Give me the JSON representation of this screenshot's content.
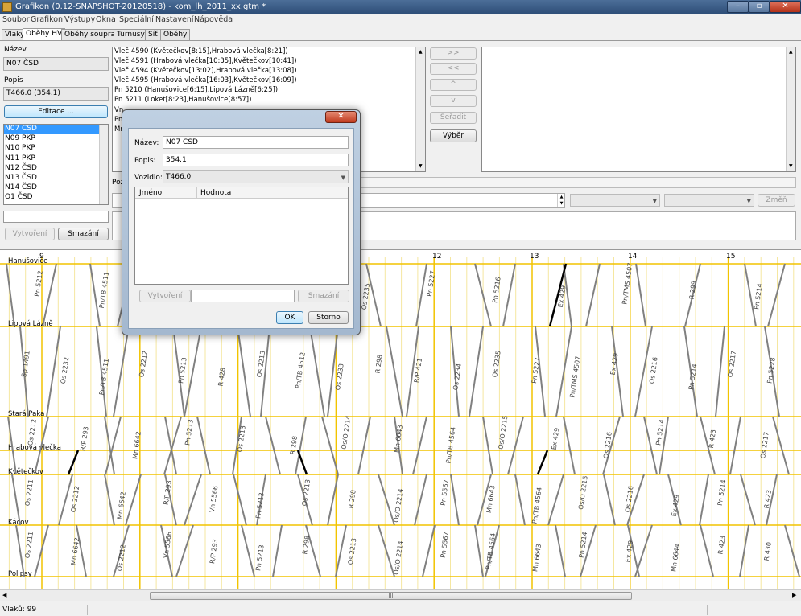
{
  "window": {
    "title": "Grafikon (0.12-SNAPSHOT-20120518) - kom_lh_2011_xx.gtm *",
    "min_glyph": "–",
    "max_glyph": "▫",
    "close_glyph": "✕"
  },
  "menu": [
    "Soubor",
    "Grafikon",
    "Výstupy",
    "Okna",
    "Speciální",
    "Nastavení",
    "Nápověda"
  ],
  "tabs": [
    "Vlaky",
    "Oběhy HV",
    "Oběhy souprav",
    "Turnusy",
    "Síť",
    "Oběhy"
  ],
  "active_tab": 1,
  "left_panel": {
    "name_label": "Název",
    "name_value": "N07 ČSD",
    "desc_label": "Popis",
    "desc_value": "T466.0 (354.1)",
    "edit_button": "Editace ...",
    "circulations": [
      "N07 ČSD",
      "N09 PKP",
      "N10 PKP",
      "N11 PKP",
      "N12 ČSD",
      "N13 ČSD",
      "N14 ČSD",
      "O1 ČSD"
    ],
    "selected_index": 0,
    "new_value": "",
    "create_button": "Vytvoření",
    "delete_button": "Smazání"
  },
  "circulation_trains": [
    "Vleč 4590 (Květečkov[8:15],Hrabová vlečka[8:21])",
    "Vleč 4591 (Hrabová vlečka[10:35],Květečkov[10:41])",
    "Vleč 4594 (Květečkov[13:02],Hrabová vlečka[13:08])",
    "Vleč 4595 (Hrabová vlečka[16:03],Květečkov[16:09])",
    "Pn 5210 (Hanušovice[6:15],Lipová Lázně[6:25])",
    "Pn 5211 (Loket[8:23],Hanušovice[8:57])",
    "Vn",
    "Pn",
    "Mn"
  ],
  "middle_buttons": {
    "add": ">>",
    "remove": "<<",
    "up": "^",
    "down": "v",
    "sort": "Seřadit",
    "select": "Výběr"
  },
  "position_label": "Poz",
  "change_button": "Změň",
  "dialog": {
    "close_glyph": "✕",
    "name_label": "Název:",
    "name_value": "N07 ČSD",
    "desc_label": "Popis:",
    "desc_value": "354.1",
    "vehicle_label": "Vozidlo:",
    "vehicle_value": "T466.0",
    "col_name": "Jméno",
    "col_value": "Hodnota",
    "create_button": "Vytvoření",
    "new_value": "",
    "delete_button": "Smazání",
    "ok_button": "OK",
    "cancel_button": "Storno"
  },
  "chart_data": {
    "type": "line",
    "hour_labels": [
      "9",
      "12",
      "13",
      "14",
      "15"
    ],
    "stations": [
      "Hanušovice",
      "Lipová Lázně",
      "Stará Paka",
      "Hrabová vlečka",
      "Květečkov",
      "Kácov",
      "Polipsy"
    ],
    "train_labels": [
      {
        "text": "Pn 5212"
      },
      {
        "text": "Pn/TB 4511"
      },
      {
        "text": "Os 2232"
      },
      {
        "text": "R/P 421"
      },
      {
        "text": "Os 2234"
      },
      {
        "text": "Os 2235"
      },
      {
        "text": "Pn 5227"
      },
      {
        "text": "Pn 5216"
      },
      {
        "text": "Ex 429"
      },
      {
        "text": "Pn/TMS 4507"
      },
      {
        "text": "R 299"
      },
      {
        "text": "Pn 5214"
      },
      {
        "text": "Sp 1491"
      },
      {
        "text": "Os 2232"
      },
      {
        "text": "Pn/TB 4511"
      },
      {
        "text": "Os 2212"
      },
      {
        "text": "Pn 5213"
      },
      {
        "text": "R 428"
      },
      {
        "text": "Os 2213"
      },
      {
        "text": "Pn/TB 4512"
      },
      {
        "text": "Os 2233"
      },
      {
        "text": "R 298"
      },
      {
        "text": "R/P 421"
      },
      {
        "text": "Os 2234"
      },
      {
        "text": "Os 2235"
      },
      {
        "text": "Pn 5227"
      },
      {
        "text": "Pn/TMS 4507"
      },
      {
        "text": "Ex 429"
      },
      {
        "text": "Os 2216"
      },
      {
        "text": "Pn 5214"
      },
      {
        "text": "Os 2217"
      },
      {
        "text": "Pn 5228"
      },
      {
        "text": "Os 2212"
      },
      {
        "text": "R/P 293"
      },
      {
        "text": "Mn 6642"
      },
      {
        "text": "Pn 5213"
      },
      {
        "text": "Os 2213"
      },
      {
        "text": "R 298"
      },
      {
        "text": "Os/O 2214"
      },
      {
        "text": "Mn 6643"
      },
      {
        "text": "Pn/TB 4564"
      },
      {
        "text": "Os/O 2215"
      },
      {
        "text": "Ex 429"
      },
      {
        "text": "Os 2216"
      },
      {
        "text": "Pn 5214"
      },
      {
        "text": "R 423"
      },
      {
        "text": "Os 2217"
      },
      {
        "text": "Os 2211"
      },
      {
        "text": "Os 2212"
      },
      {
        "text": "Mn 6642"
      },
      {
        "text": "R/P 293"
      },
      {
        "text": "Vn 5566"
      },
      {
        "text": "Pn 5213"
      },
      {
        "text": "Os 2213"
      },
      {
        "text": "R 298"
      },
      {
        "text": "Os/O 2214"
      },
      {
        "text": "Pn 5567"
      },
      {
        "text": "Mn 6643"
      },
      {
        "text": "Pn/TB 4564"
      },
      {
        "text": "Os/O 2215"
      },
      {
        "text": "Os 2216"
      },
      {
        "text": "Ex 429"
      },
      {
        "text": "Pn 5214"
      },
      {
        "text": "R 423"
      },
      {
        "text": "Os 2211"
      },
      {
        "text": "Mn 6642"
      },
      {
        "text": "Os 2212"
      },
      {
        "text": "Vn 5566"
      },
      {
        "text": "R/P 293"
      },
      {
        "text": "Pn 5213"
      },
      {
        "text": "R 298"
      },
      {
        "text": "Os 2213"
      },
      {
        "text": "Os/O 2214"
      },
      {
        "text": "Pn 5567"
      },
      {
        "text": "Pn/TB 4564"
      },
      {
        "text": "Mn 6643"
      },
      {
        "text": "Pn 5214"
      },
      {
        "text": "Ex 429"
      },
      {
        "text": "Mn 6644"
      },
      {
        "text": "R 423"
      },
      {
        "text": "R 430"
      }
    ],
    "colors": {
      "grid_major": "#f2c400",
      "grid_minor": "#f5e7a0",
      "train": "#808080",
      "highlight": "#000000"
    }
  },
  "scrollbar": {
    "thumb_glyph": "III"
  },
  "status": {
    "trains_count": "Vlaků: 99"
  }
}
